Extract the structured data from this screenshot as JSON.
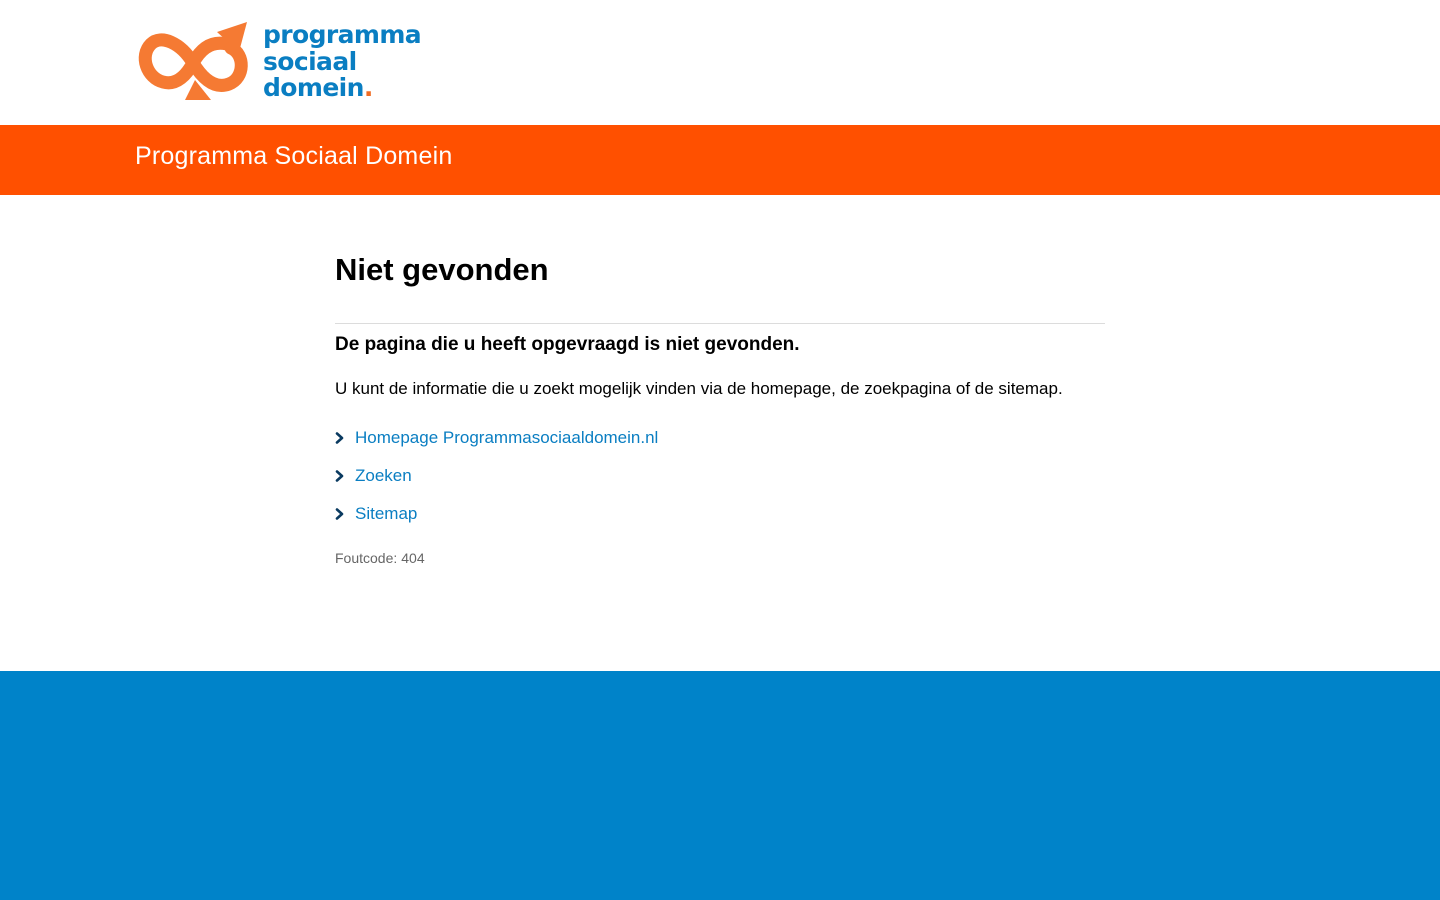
{
  "header": {
    "logo_alt": "programma sociaal domein logo",
    "logo_lines": [
      "programma",
      "sociaal",
      "domein"
    ],
    "logo_dot": ".",
    "logo_icon": "infinity-arrow-icon"
  },
  "banner": {
    "title": "Programma Sociaal Domein"
  },
  "main": {
    "heading": "Niet gevonden",
    "lead": "De pagina die u heeft opgevraagd is niet gevonden.",
    "body": "U kunt de informatie die u zoekt mogelijk vinden via de homepage, de zoekpagina of de sitemap.",
    "links": [
      {
        "label": "Homepage Programmasociaaldomein.nl",
        "icon": "chevron-right-icon"
      },
      {
        "label": "Zoeken",
        "icon": "chevron-right-icon"
      },
      {
        "label": "Sitemap",
        "icon": "chevron-right-icon"
      }
    ],
    "error_label": "Foutcode:",
    "error_value": "404"
  },
  "colors": {
    "banner": "#ff5000",
    "brand_blue": "#0a7ec2",
    "brand_orange": "#f06b22",
    "footer": "#0083c9"
  }
}
